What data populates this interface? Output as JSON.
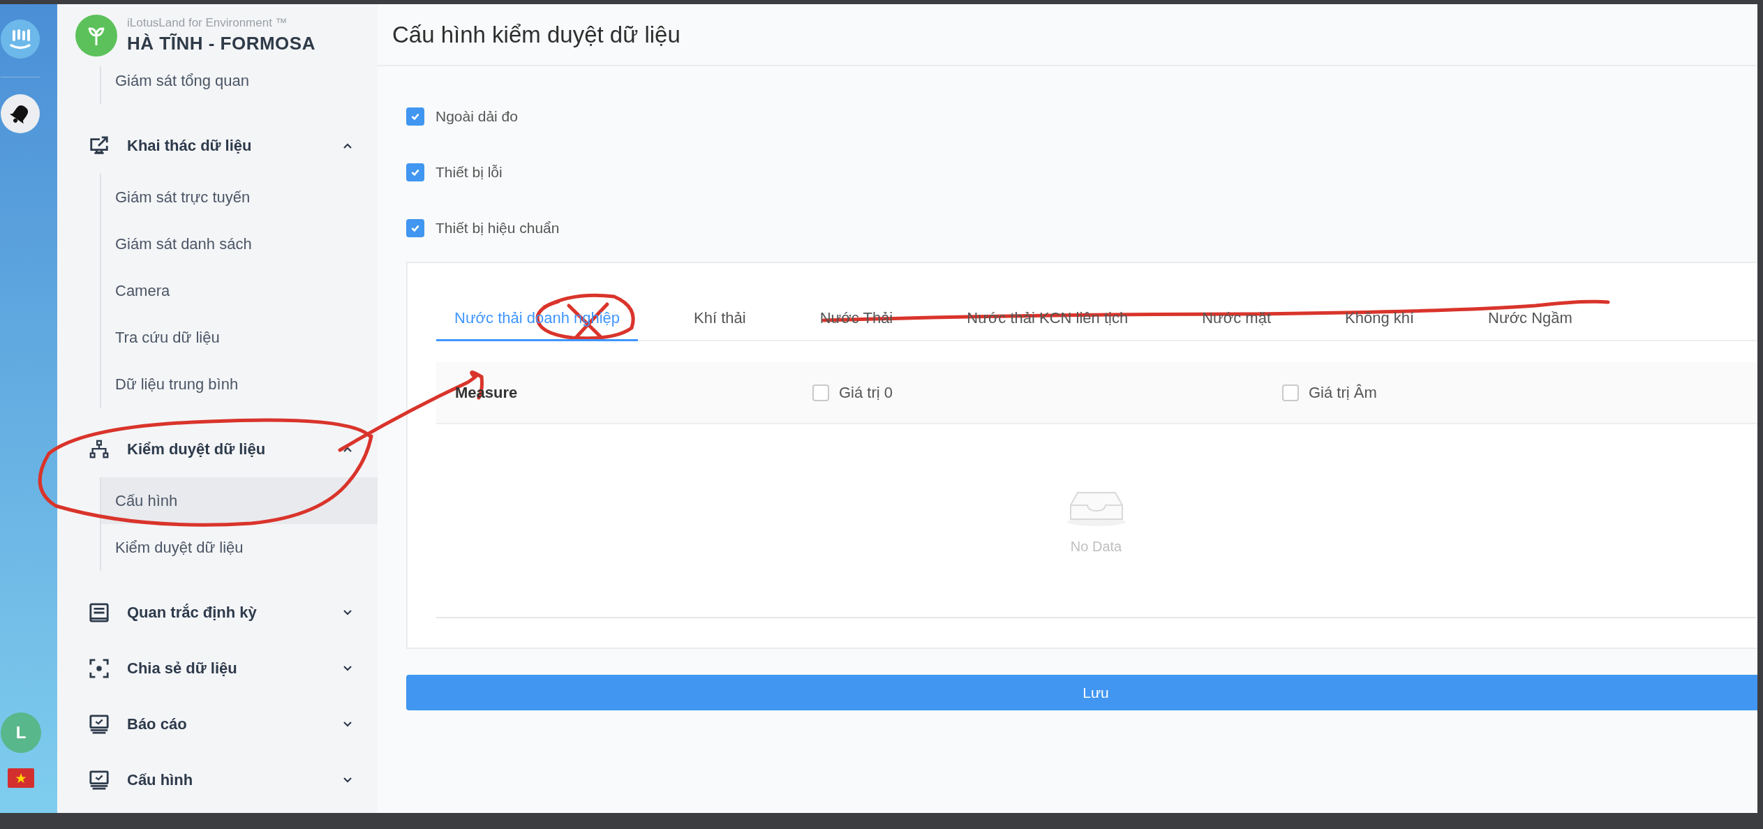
{
  "rail": {
    "avatar": "L"
  },
  "brand": {
    "subtitle": "iLotusLand for Environment ™",
    "title": "HÀ TĨNH - FORMOSA"
  },
  "sidebar": {
    "items": [
      {
        "kind": "sub",
        "label": "Giám sát tổng quan"
      },
      {
        "kind": "group",
        "label": "Khai thác dữ liệu",
        "expanded": true,
        "children": [
          {
            "label": "Giám sát trực tuyến",
            "selected": false
          },
          {
            "label": "Giám sát danh sách",
            "selected": false
          },
          {
            "label": "Camera",
            "selected": false
          },
          {
            "label": "Tra cứu dữ liệu",
            "selected": false
          },
          {
            "label": "Dữ liệu trung bình",
            "selected": false
          }
        ]
      },
      {
        "kind": "group",
        "label": "Kiểm duyệt dữ liệu",
        "expanded": true,
        "children": [
          {
            "label": "Cấu hình",
            "selected": true
          },
          {
            "label": "Kiểm duyệt dữ liệu",
            "selected": false
          }
        ]
      },
      {
        "kind": "group",
        "label": "Quan trắc định kỳ",
        "expanded": false
      },
      {
        "kind": "group",
        "label": "Chia sẻ dữ liệu",
        "expanded": false
      },
      {
        "kind": "group",
        "label": "Báo cáo",
        "expanded": false
      },
      {
        "kind": "group",
        "label": "Cấu hình",
        "expanded": false
      }
    ]
  },
  "page": {
    "title": "Cấu hình kiểm duyệt dữ liệu",
    "options": [
      {
        "label": "Ngoài dải đo",
        "checked": true
      },
      {
        "label": "Thiết bị lỗi",
        "checked": true
      },
      {
        "label": "Thiết bị hiệu chuẩn",
        "checked": true
      }
    ],
    "tabs": [
      {
        "label": "Nước thải doanh nghiệp",
        "selected": true
      },
      {
        "label": "Khí thải",
        "selected": false
      },
      {
        "label": "Nước Thải",
        "selected": false
      },
      {
        "label": "Nước thải KCN liên tịch",
        "selected": false
      },
      {
        "label": "Nước mặt",
        "selected": false
      },
      {
        "label": "Không khí",
        "selected": false
      },
      {
        "label": "Nước Ngầm",
        "selected": false
      }
    ],
    "table": {
      "columns": [
        {
          "kind": "text",
          "label": "Measure"
        },
        {
          "kind": "checkbox",
          "label": "Giá trị 0",
          "checked": false
        },
        {
          "kind": "checkbox",
          "label": "Giá trị Âm",
          "checked": false
        }
      ],
      "empty_text": "No Data"
    },
    "save_button": "Lưu"
  }
}
